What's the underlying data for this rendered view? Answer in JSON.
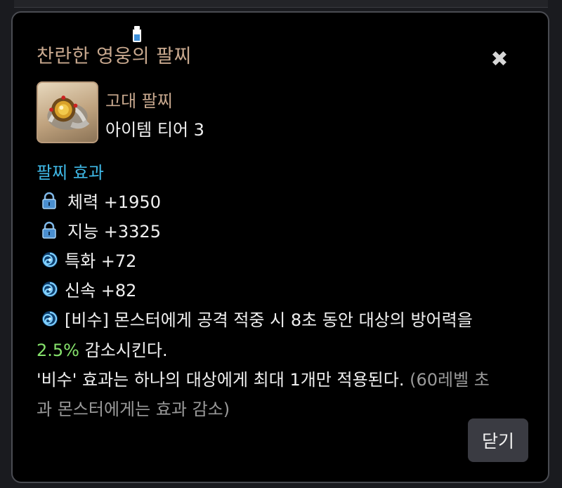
{
  "dialog": {
    "title": "찬란한 영웅의 팔찌",
    "close_icon": "close-icon",
    "status_icon": "bottle-icon"
  },
  "item": {
    "image_icon": "bracelet-icon",
    "type": "고대 팔찌",
    "tier": "아이템 티어 3"
  },
  "effects": {
    "section_title": "팔찌 효과",
    "stats": [
      {
        "icon": "lock-icon",
        "text": "체력 +1950"
      },
      {
        "icon": "lock-icon",
        "text": "지능 +3325"
      },
      {
        "icon": "swirl-icon",
        "text": "특화 +72"
      },
      {
        "icon": "swirl-icon",
        "text": "신속 +82"
      }
    ],
    "special": {
      "icon": "swirl-icon",
      "line1": "[비수] 몬스터에게 공격 적중 시 8초 동안 대상의 방어력을",
      "value": "2.5%",
      "line2_rest": " 감소시킨다.",
      "line3": "'비수' 효과는 하나의 대상에게 최대 1개만 적용된다.",
      "note_part1": " (60레벨 초",
      "note_part2": "과 몬스터에게는 효과 감소)"
    }
  },
  "footer": {
    "close_label": "닫기"
  },
  "colors": {
    "title": "#c8a88e",
    "section": "#3fb8e6",
    "highlight": "#86e36c",
    "note": "#9a9a9a"
  }
}
